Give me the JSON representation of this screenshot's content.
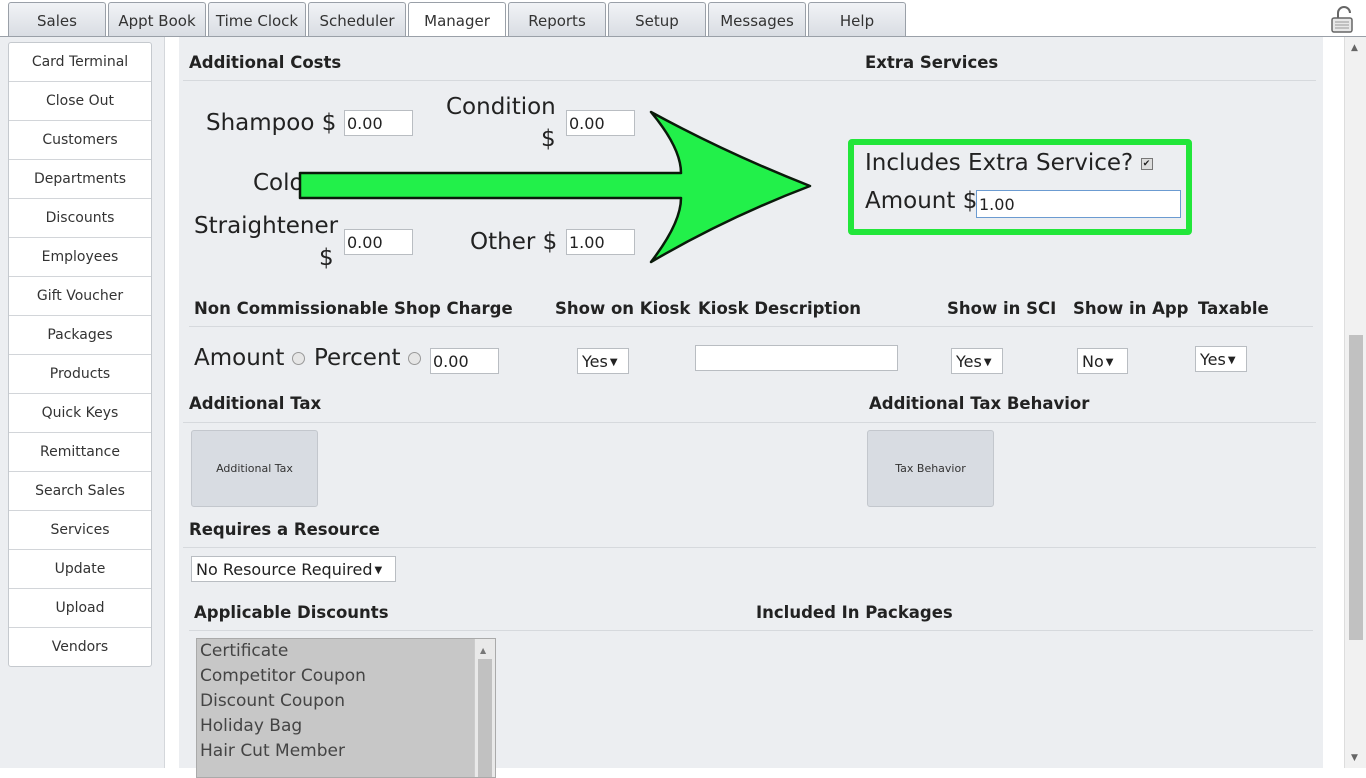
{
  "tabs": [
    "Sales",
    "Appt Book",
    "Time Clock",
    "Scheduler",
    "Manager",
    "Reports",
    "Setup",
    "Messages",
    "Help"
  ],
  "active_tab": "Manager",
  "sidebar": [
    "Card Terminal",
    "Close Out",
    "Customers",
    "Departments",
    "Discounts",
    "Employees",
    "Gift Voucher",
    "Packages",
    "Products",
    "Quick Keys",
    "Remittance",
    "Search Sales",
    "Services",
    "Update",
    "Upload",
    "Vendors"
  ],
  "additional_costs": {
    "title": "Additional Costs",
    "shampoo_label": "Shampoo $",
    "shampoo_value": "0.00",
    "condition_label": "Condition",
    "condition_dollar": "$",
    "condition_value": "0.00",
    "color_label": "Colo",
    "straightener_label": "Straightener",
    "straightener_dollar": "$",
    "straightener_value": "0.00",
    "other_label": "Other $",
    "other_value": "1.00"
  },
  "extra_services": {
    "title": "Extra Services",
    "includes_label": "Includes Extra Service?",
    "checked": true,
    "amount_label": "Amount $",
    "amount_value": "1.00"
  },
  "shop_charge": {
    "headers": [
      "Non Commissionable Shop Charge",
      "Show on Kiosk",
      "Kiosk Description",
      "Show in SCI",
      "Show in App",
      "Taxable"
    ],
    "amount_label": "Amount",
    "percent_label": "Percent",
    "value": "0.00",
    "kiosk": "Yes",
    "kiosk_description": "",
    "sci": "Yes",
    "app": "No",
    "taxable": "Yes"
  },
  "additional_tax": {
    "title": "Additional Tax",
    "button": "Additional Tax"
  },
  "tax_behavior": {
    "title": "Additional Tax Behavior",
    "button": "Tax Behavior"
  },
  "resource": {
    "title": "Requires a Resource",
    "selected": "No Resource Required"
  },
  "discounts": {
    "title": "Applicable Discounts",
    "items": [
      "Certificate",
      "Competitor Coupon",
      "Discount Coupon",
      "Holiday Bag",
      "Hair Cut Member"
    ]
  },
  "packages": {
    "title": "Included In Packages"
  },
  "colors": {
    "highlight": "#22e63a",
    "arrow": "#22f04a",
    "panel": "#eceef1"
  }
}
